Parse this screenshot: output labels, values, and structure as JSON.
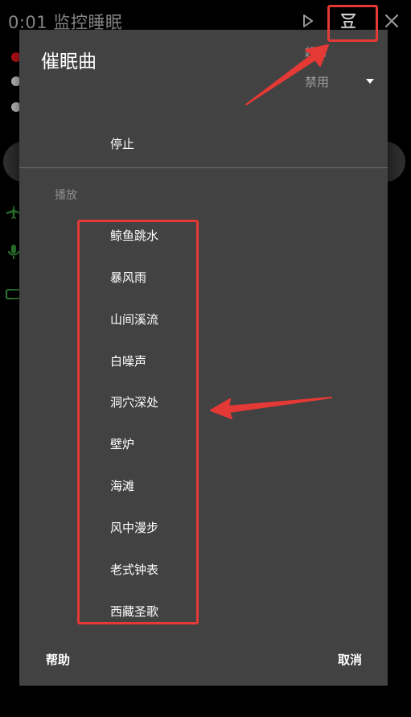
{
  "app": {
    "title": "0:01 监控睡眠",
    "icons": [
      "play-icon",
      "sleep-mask-icon",
      "close-icon"
    ]
  },
  "dialog": {
    "title": "催眠曲",
    "timeout_label": "超时",
    "timeout_value": "禁用",
    "stop_label": "停止",
    "section_label": "播放",
    "items": [
      "鲸鱼跳水",
      "暴风雨",
      "山间溪流",
      "白噪声",
      "洞穴深处",
      "壁炉",
      "海滩",
      "风中漫步",
      "老式钟表",
      "西藏圣歌"
    ],
    "help_label": "帮助",
    "cancel_label": "取消"
  },
  "colors": {
    "dialog_bg": "#424242",
    "annotation": "#e53935",
    "background": "#000000"
  }
}
